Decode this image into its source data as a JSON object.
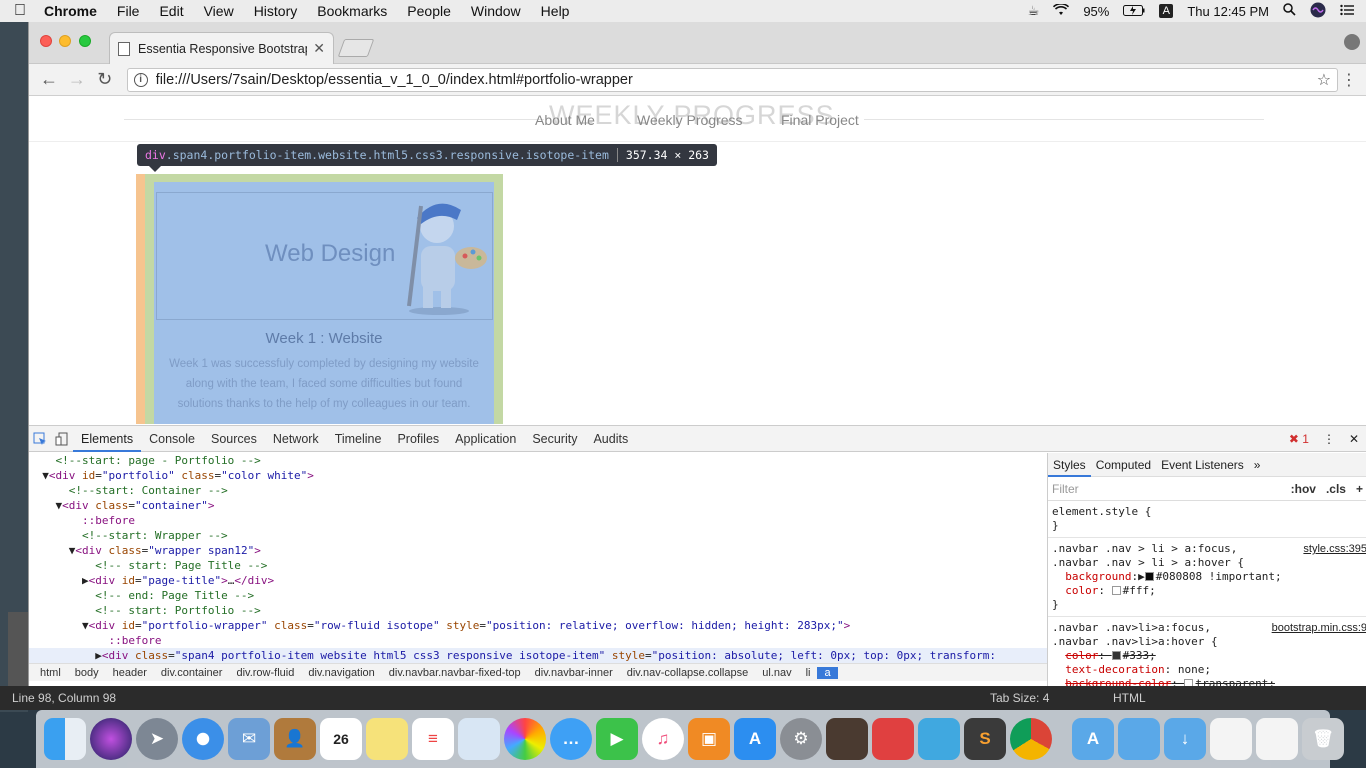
{
  "menubar": {
    "app_name": "Chrome",
    "items": [
      "File",
      "Edit",
      "View",
      "History",
      "Bookmarks",
      "People",
      "Window",
      "Help"
    ],
    "battery": "95%",
    "input_source": "A",
    "clock": "Thu 12:45 PM"
  },
  "browser": {
    "tab_title": "Essentia Responsive Bootstrap",
    "url": "file:///Users/7sain/Desktop/essentia_v_1_0_0/index.html#portfolio-wrapper"
  },
  "page": {
    "nav_title": "WEEKLY PROGRESS",
    "nav_links": [
      "About Me",
      "Weekly Progress",
      "Final Project"
    ],
    "tooltip_tag": "div",
    "tooltip_classes": ".span4.portfolio-item.website.html5.css3.responsive.isotope-item",
    "tooltip_size": "357.34 × 263",
    "image_title": "Web Design",
    "card_title": "Week 1 : Website",
    "card_text": "Week 1 was successfuly completed by designing my website along with the team, I faced some difficulties but found solutions thanks to the help of my colleagues in our team."
  },
  "devtools": {
    "tabs": [
      "Elements",
      "Console",
      "Sources",
      "Network",
      "Timeline",
      "Profiles",
      "Application",
      "Security",
      "Audits"
    ],
    "active_tab": "Elements",
    "error_count": "1",
    "breadcrumb": [
      "html",
      "body",
      "header",
      "div.container",
      "div.row-fluid",
      "div.navigation",
      "div.navbar.navbar-fixed-top",
      "div.navbar-inner",
      "div.nav-collapse.collapse",
      "ul.nav",
      "li",
      "a"
    ],
    "styles_tabs": [
      "Styles",
      "Computed",
      "Event Listeners"
    ],
    "filter_placeholder": "Filter",
    "hov": ":hov",
    "cls": ".cls",
    "rule1_src": "style.css:395",
    "rule2_src": "bootstrap.min.css:9"
  },
  "statusbar": {
    "position": "Line 98, Column 98",
    "tab_size": "Tab Size: 4",
    "syntax": "HTML"
  },
  "colors": {
    "highlight_content": "#a0c0e8",
    "highlight_padding": "#c3d8a4",
    "highlight_margin": "#f6c48f",
    "accent": "#3879d9"
  }
}
